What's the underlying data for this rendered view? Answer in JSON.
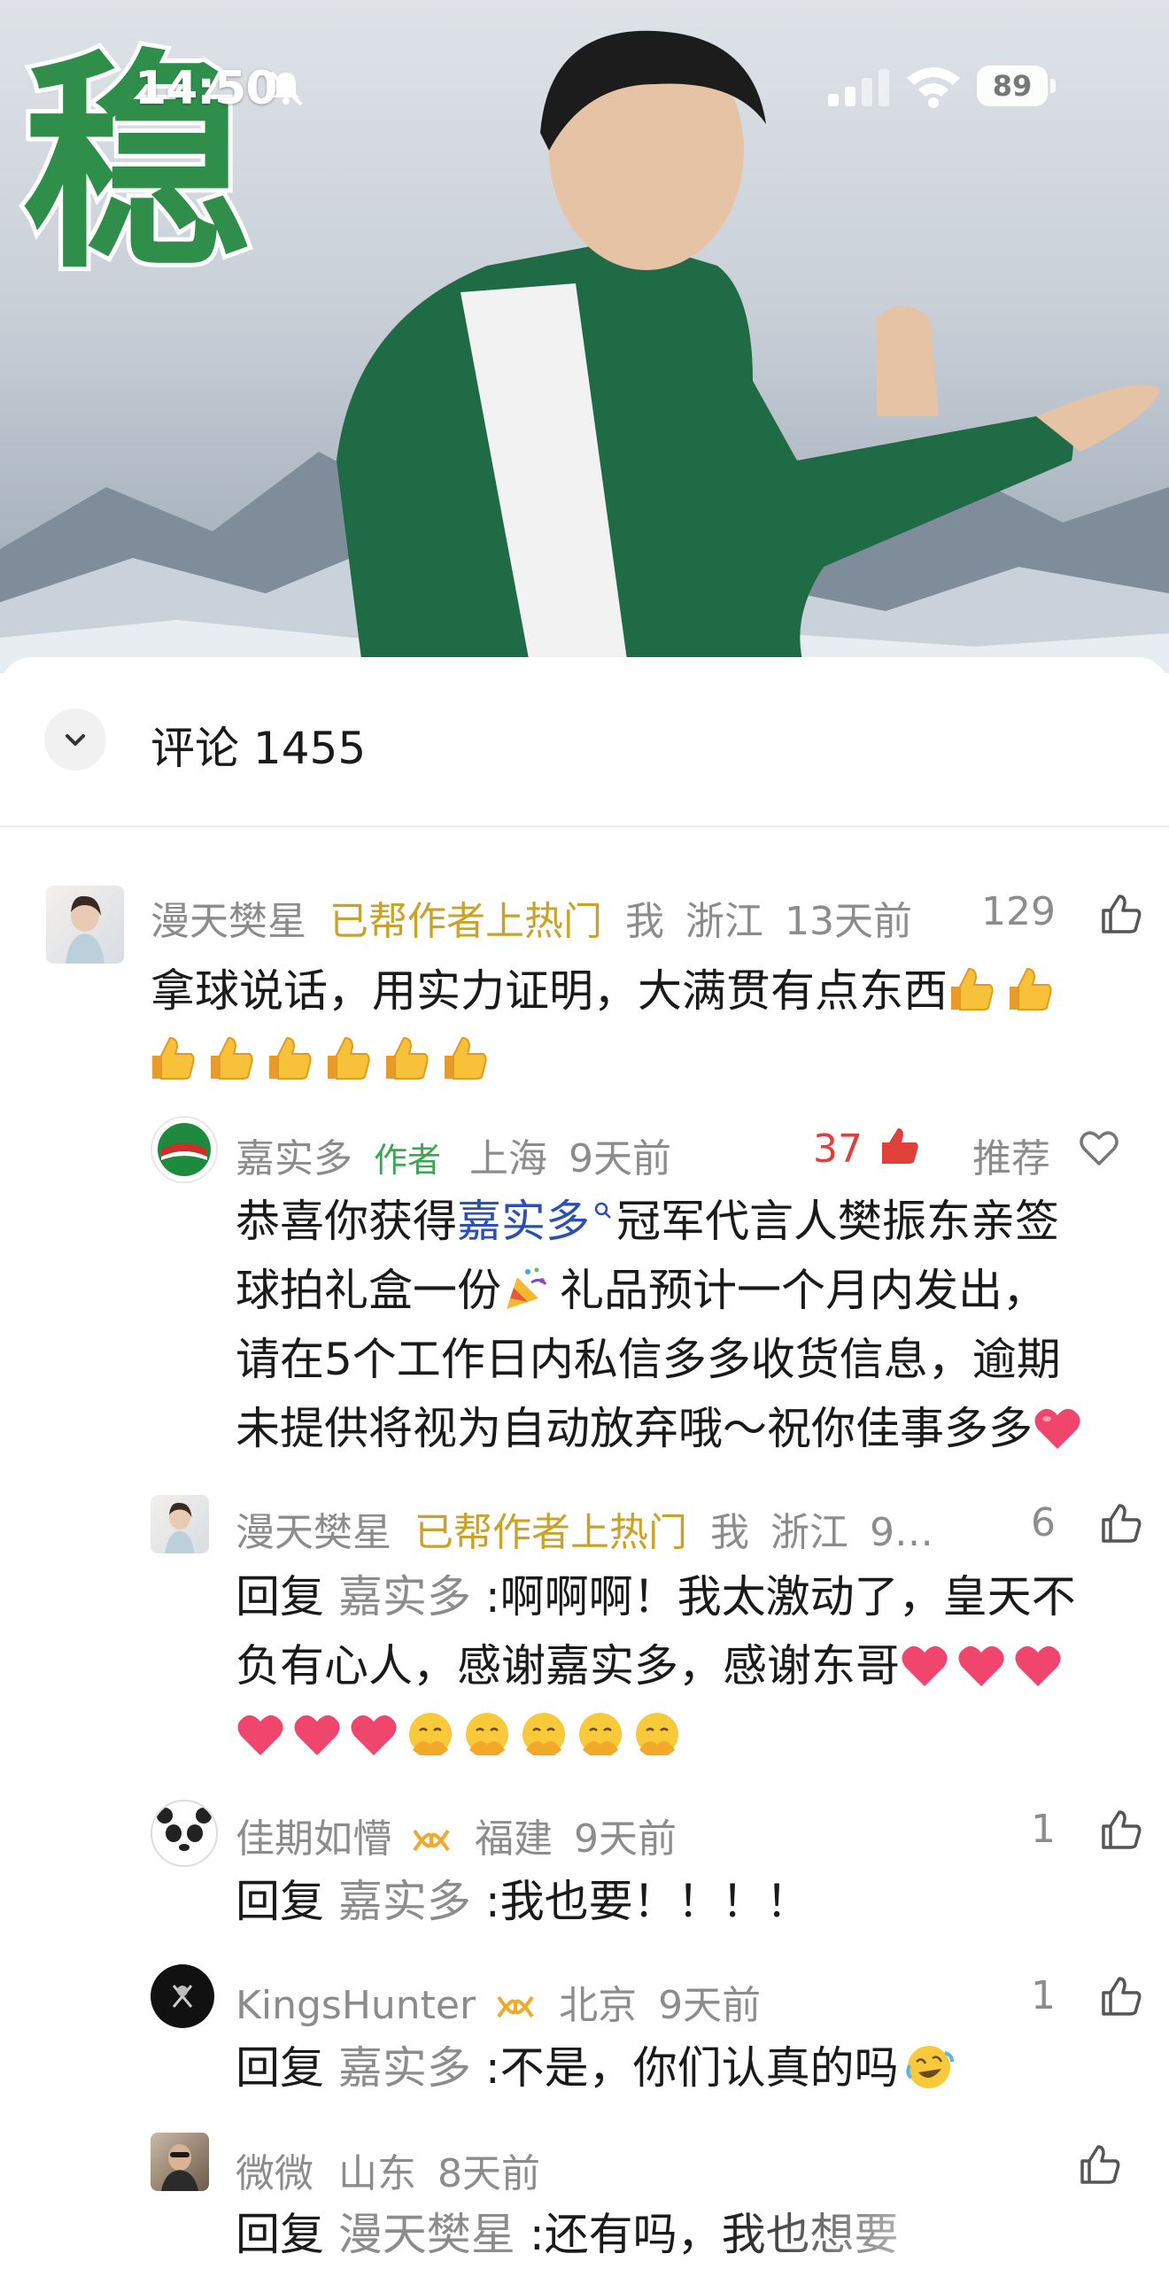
{
  "status_bar": {
    "time": "14:50",
    "battery": "89"
  },
  "video": {
    "calligraphy_char": "稳"
  },
  "comments_header": {
    "title": "评论 1455"
  },
  "comments": [
    {
      "user": "漫天樊星",
      "badge": "已帮作者上热门",
      "me": "我",
      "location": "浙江",
      "time": "13天前",
      "likes": "129",
      "line1": "拿球说话，用实力证明，大满贯有点东西"
    },
    {
      "user": "嘉实多",
      "author_tag": "作者",
      "location": "上海",
      "time": "9天前",
      "likes": "37",
      "recommend": "推荐",
      "line1_a": "恭喜你获得",
      "line1_link": "嘉实多",
      "line1_b": "冠军代言人樊振东亲签",
      "line2_a": "球拍礼盒一份",
      "line2_b": "礼品预计一个月内发出，",
      "line3": "请在5个工作日内私信多多收货信息，逾期",
      "line4": "未提供将视为自动放弃哦～祝你佳事多多"
    },
    {
      "user": "漫天樊星",
      "badge": "已帮作者上热门",
      "me": "我",
      "location": "浙江",
      "time": "9…",
      "likes": "6",
      "reply_label": "回复",
      "reply_to": "嘉实多",
      "line1": ":啊啊啊！我太激动了，皇天不",
      "line2": "负有心人，感谢嘉实多，感谢东哥"
    },
    {
      "user": "佳期如懵",
      "location": "福建",
      "time": "9天前",
      "likes": "1",
      "reply_label": "回复",
      "reply_to": "嘉实多",
      "line1": ":我也要！！！！"
    },
    {
      "user": "KingsHunter",
      "location": "北京",
      "time": "9天前",
      "likes": "1",
      "reply_label": "回复",
      "reply_to": "嘉实多",
      "line1": ":不是，你们认真的吗"
    },
    {
      "user": "微微",
      "location": "山东",
      "time": "8天前",
      "likes": "",
      "reply_label": "回复",
      "reply_to": "漫天樊星",
      "line1": ":还有吗，我也想要"
    }
  ],
  "colors": {
    "badge_gold": "#c9a227",
    "author_green": "#3aa654",
    "like_red": "#e0403a",
    "link_blue": "#2a4fb8"
  }
}
